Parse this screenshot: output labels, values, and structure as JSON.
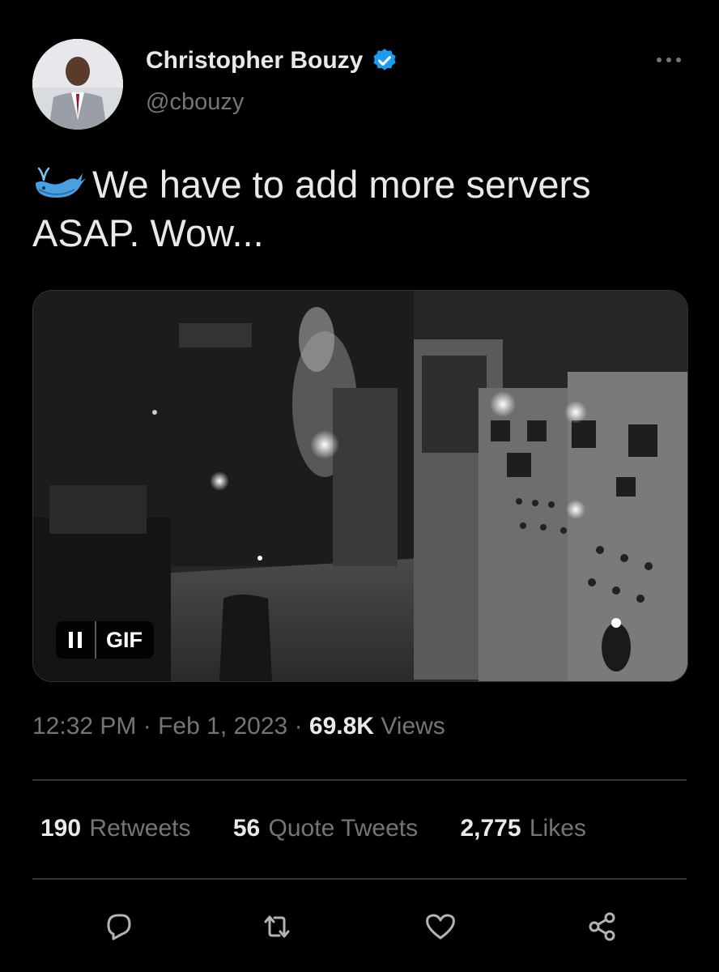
{
  "author": {
    "display_name": "Christopher Bouzy",
    "handle": "@cbouzy",
    "verified": true,
    "avatar_icon": "profile-photo"
  },
  "tweet": {
    "emoji": "whale-emoji",
    "text": "We have to add more servers ASAP. Wow..."
  },
  "media": {
    "type": "gif",
    "badge_label": "GIF",
    "playback_state": "playing"
  },
  "meta": {
    "time": "12:32 PM",
    "separator": "·",
    "date": "Feb 1, 2023",
    "views_count": "69.8K",
    "views_label": "Views"
  },
  "stats": {
    "retweets_count": "190",
    "retweets_label": "Retweets",
    "quotes_count": "56",
    "quotes_label": "Quote Tweets",
    "likes_count": "2,775",
    "likes_label": "Likes"
  },
  "actions": {
    "reply_icon": "reply-icon",
    "retweet_icon": "retweet-icon",
    "like_icon": "heart-icon",
    "share_icon": "share-icon"
  },
  "colors": {
    "background": "#000000",
    "primary_text": "#e7e9ea",
    "secondary_text": "#71767b",
    "divider": "#2f3336",
    "verified_blue": "#1d9bf0"
  }
}
